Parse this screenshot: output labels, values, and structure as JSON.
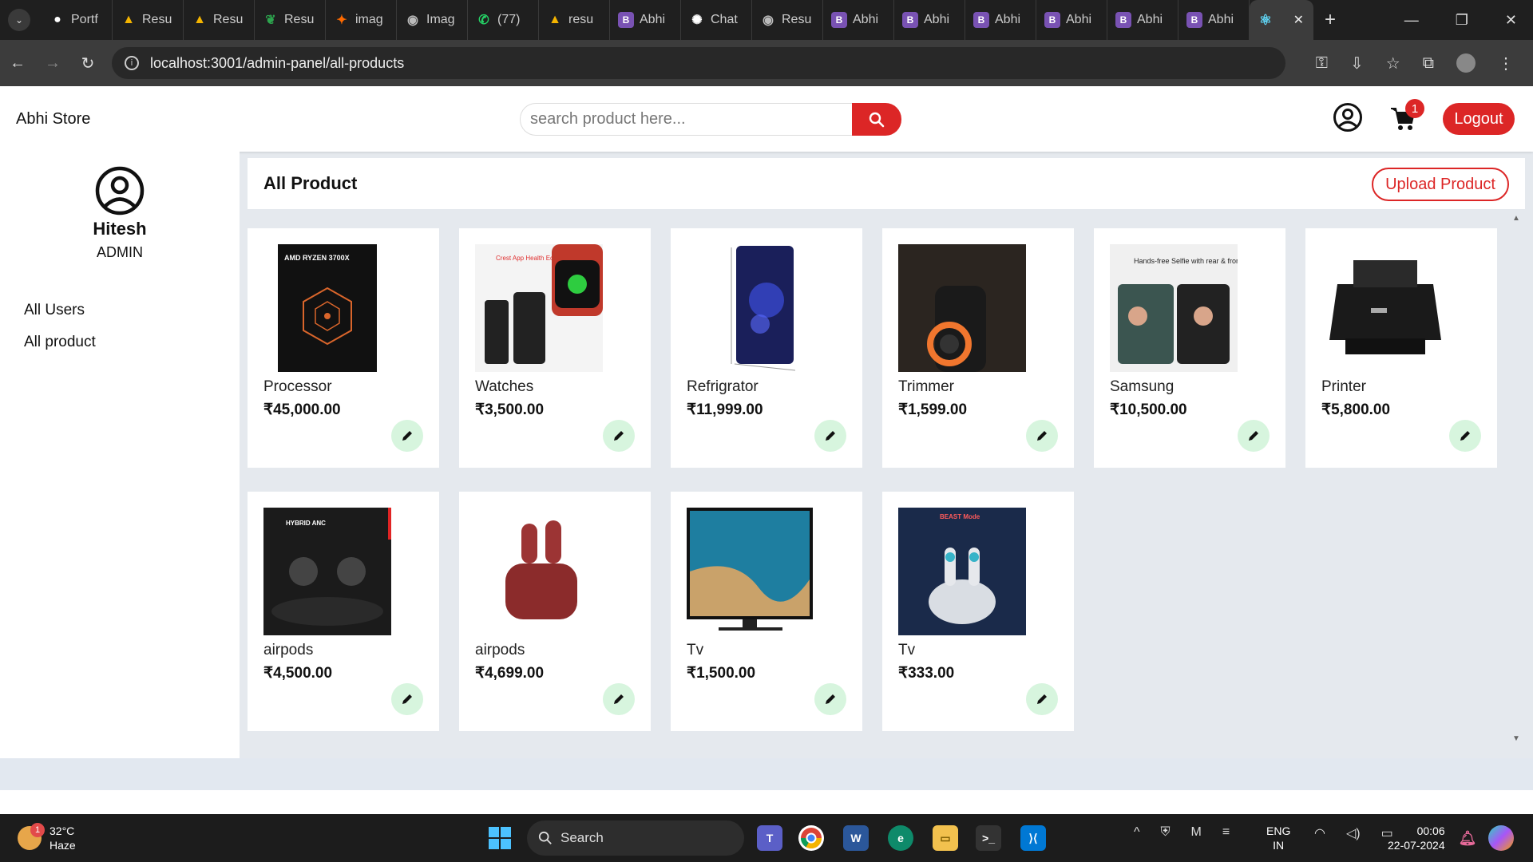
{
  "browser": {
    "tabs": [
      {
        "label": "Portf",
        "icon": "github-icon"
      },
      {
        "label": "Resu",
        "icon": "drive-icon"
      },
      {
        "label": "Resu",
        "icon": "drive-icon"
      },
      {
        "label": "Resu",
        "icon": "leaf-icon"
      },
      {
        "label": "imag",
        "icon": "image-icon"
      },
      {
        "label": "Imag",
        "icon": "globe-icon"
      },
      {
        "label": "(77)",
        "icon": "whatsapp-icon"
      },
      {
        "label": "resu",
        "icon": "drive-icon"
      },
      {
        "label": "Abhi",
        "icon": "bootstrap-icon"
      },
      {
        "label": "Chat",
        "icon": "chatgpt-icon"
      },
      {
        "label": "Resu",
        "icon": "globe-icon"
      },
      {
        "label": "Abhi",
        "icon": "bootstrap-icon"
      },
      {
        "label": "Abhi",
        "icon": "bootstrap-icon"
      },
      {
        "label": "Abhi",
        "icon": "bootstrap-icon"
      },
      {
        "label": "Abhi",
        "icon": "bootstrap-icon"
      },
      {
        "label": "Abhi",
        "icon": "bootstrap-icon"
      },
      {
        "label": "Abhi",
        "icon": "bootstrap-icon"
      }
    ],
    "active_tab_icon": "react-icon",
    "url": "localhost:3001/admin-panel/all-products"
  },
  "header": {
    "logo": "Abhi Store",
    "search_placeholder": "search product here...",
    "cart_count": "1",
    "logout_label": "Logout"
  },
  "sidebar": {
    "name": "Hitesh",
    "role": "ADMIN",
    "links": [
      "All Users",
      "All product"
    ]
  },
  "main": {
    "title": "All Product",
    "upload_label": "Upload Product"
  },
  "products": [
    {
      "name": "Processor",
      "price": "₹45,000.00"
    },
    {
      "name": "Watches",
      "price": "₹3,500.00"
    },
    {
      "name": "Refrigrator",
      "price": "₹11,999.00"
    },
    {
      "name": "Trimmer",
      "price": "₹1,599.00"
    },
    {
      "name": "Samsung",
      "price": "₹10,500.00"
    },
    {
      "name": "Printer",
      "price": "₹5,800.00"
    },
    {
      "name": "airpods",
      "price": "₹4,500.00"
    },
    {
      "name": "airpods",
      "price": "₹4,699.00"
    },
    {
      "name": "Tv",
      "price": "₹1,500.00"
    },
    {
      "name": "Tv",
      "price": "₹333.00"
    }
  ],
  "product_image_text": {
    "processor": "AMD RYZEN 3700X",
    "watch": "Crest App Health Ecosystem",
    "samsung": "Hands-free Selfie with rear & front camera",
    "airpods": "HYBRID ANC",
    "tv2": "BEAST Mode"
  },
  "taskbar": {
    "temp": "32°C",
    "weather": "Haze",
    "weather_badge": "1",
    "search_label": "Search",
    "lang_top": "ENG",
    "lang_bottom": "IN",
    "time": "00:06",
    "date": "22-07-2024"
  },
  "colors": {
    "accent": "#dc2626",
    "edit_bg": "#d7f5de"
  }
}
